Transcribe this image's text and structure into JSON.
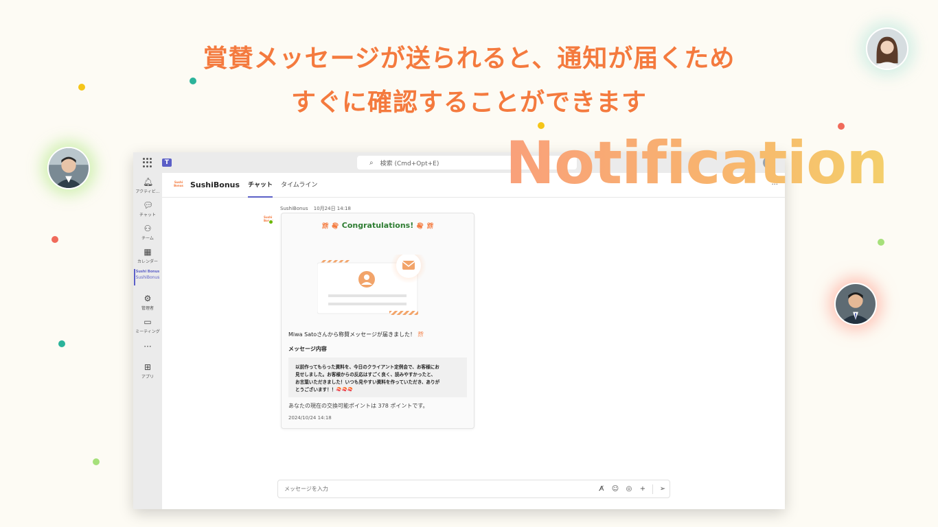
{
  "headline": {
    "line1": "賞賛メッセージが送られると、通知が届くため",
    "line2": "すぐに確認することができます",
    "color": "#f47a3e"
  },
  "overlay": {
    "word": "Notification"
  },
  "window": {
    "search_placeholder": "検索 (Cmd+Opt+E)",
    "rail": [
      {
        "icon": "bell-icon",
        "label": "アクティビ..."
      },
      {
        "icon": "chat-icon",
        "label": "チャット"
      },
      {
        "icon": "teams-icon",
        "label": "チーム"
      },
      {
        "icon": "calendar-icon",
        "label": "カレンダー"
      },
      {
        "icon": "sushibonus-app-icon",
        "label": "SushiBonus",
        "mini": "Sushi Bonus",
        "active": true
      },
      {
        "icon": "admin-icon",
        "label": "管理者"
      },
      {
        "icon": "video-icon",
        "label": "ミーティング"
      },
      {
        "icon": "more-icon",
        "label": ""
      },
      {
        "icon": "add-app-icon",
        "label": "アプリ"
      }
    ],
    "channel": {
      "logo_text": "Sushi Bonus",
      "name": "SushiBonus",
      "tabs": [
        "チャット",
        "タイムライン"
      ],
      "active_tab": 0
    },
    "message": {
      "sender": "SushiBonus",
      "time": "10月24日 14:18",
      "card": {
        "title": "Congratulations!",
        "title_color": "#2e7d32",
        "notice": "Miwa Satoさんから称賛メッセージが届きました！",
        "section_label": "メッセージ内容",
        "quote_lines": [
          "以前作ってもらった資料を、今日のクライアント定例会で、お客様にお",
          "見せしました。お客様からの反応はすごく良く、読みやすかったと、",
          "お言葉いただきました！いつも見やすい資料を作っていただき、ありが",
          "とうございます！！🍣🍣🍣"
        ],
        "points": "あなたの現在の交換可能ポイントは 378 ポイントです。",
        "date": "2024/10/24 14:18"
      }
    },
    "compose": {
      "placeholder": "メッセージを入力"
    }
  }
}
